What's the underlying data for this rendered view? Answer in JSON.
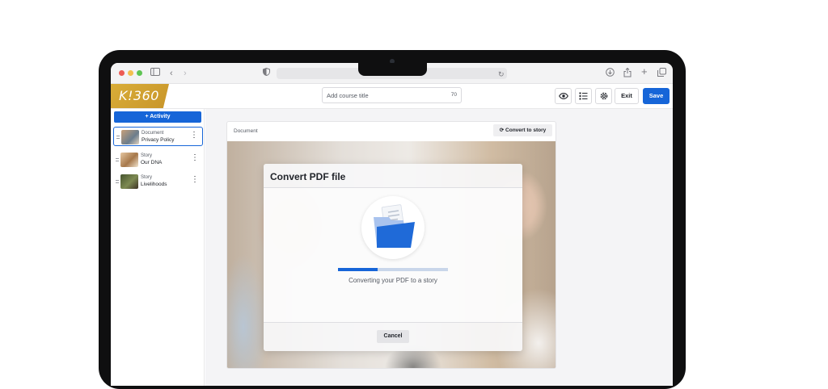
{
  "app": {
    "logo_text": "K!360",
    "course_title_placeholder": "Add course title",
    "course_title_limit": "70",
    "exit_label": "Exit",
    "save_label": "Save"
  },
  "sidebar": {
    "add_activity_label": "+ Activity",
    "items": [
      {
        "type": "Document",
        "name": "Privacy Policy",
        "active": true
      },
      {
        "type": "Story",
        "name": "Our DNA",
        "active": false
      },
      {
        "type": "Story",
        "name": "Livelihoods",
        "active": false
      }
    ]
  },
  "main": {
    "card_label": "Document",
    "convert_button_label": "Convert to story"
  },
  "modal": {
    "title": "Convert PDF file",
    "progress_text": "Converting your PDF to a story",
    "progress": 0.36,
    "cancel_label": "Cancel"
  },
  "colors": {
    "accent": "#1665d8",
    "logo_gold": "#d9ad38"
  },
  "icons": [
    "shield-icon",
    "reload-icon",
    "download-icon",
    "share-icon",
    "plus-icon",
    "tabs-icon",
    "eye-icon",
    "outline-icon",
    "settings-icon",
    "convert-icon",
    "folder-icon"
  ]
}
